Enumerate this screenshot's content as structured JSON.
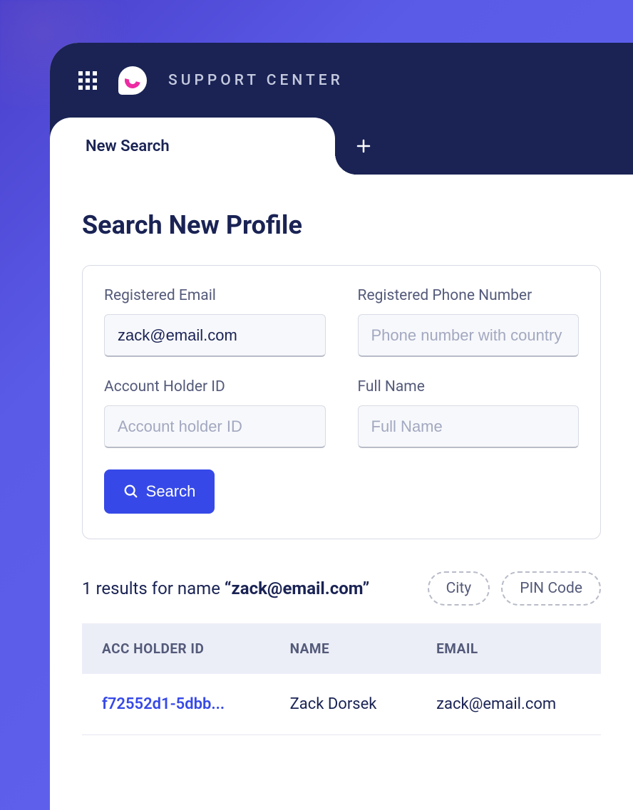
{
  "header": {
    "app_title": "SUPPORT CENTER"
  },
  "tabs": {
    "active": "New Search"
  },
  "page": {
    "title": "Search New Profile"
  },
  "form": {
    "email": {
      "label": "Registered Email",
      "value": "zack@email.com",
      "placeholder": ""
    },
    "phone": {
      "label": "Registered Phone Number",
      "value": "",
      "placeholder": "Phone number with country code"
    },
    "account_id": {
      "label": "Account Holder ID",
      "value": "",
      "placeholder": "Account holder ID"
    },
    "full_name": {
      "label": "Full Name",
      "value": "",
      "placeholder": "Full Name"
    },
    "search_button": "Search"
  },
  "results": {
    "count_prefix": "1 results for name ",
    "query": "“zack@email.com”",
    "filters": [
      "City",
      "PIN Code"
    ],
    "columns": [
      "ACC HOLDER ID",
      "NAME",
      "EMAIL"
    ],
    "rows": [
      {
        "acc_holder_id": "f72552d1-5dbb...",
        "name": "Zack Dorsek",
        "email": "zack@email.com"
      }
    ]
  }
}
